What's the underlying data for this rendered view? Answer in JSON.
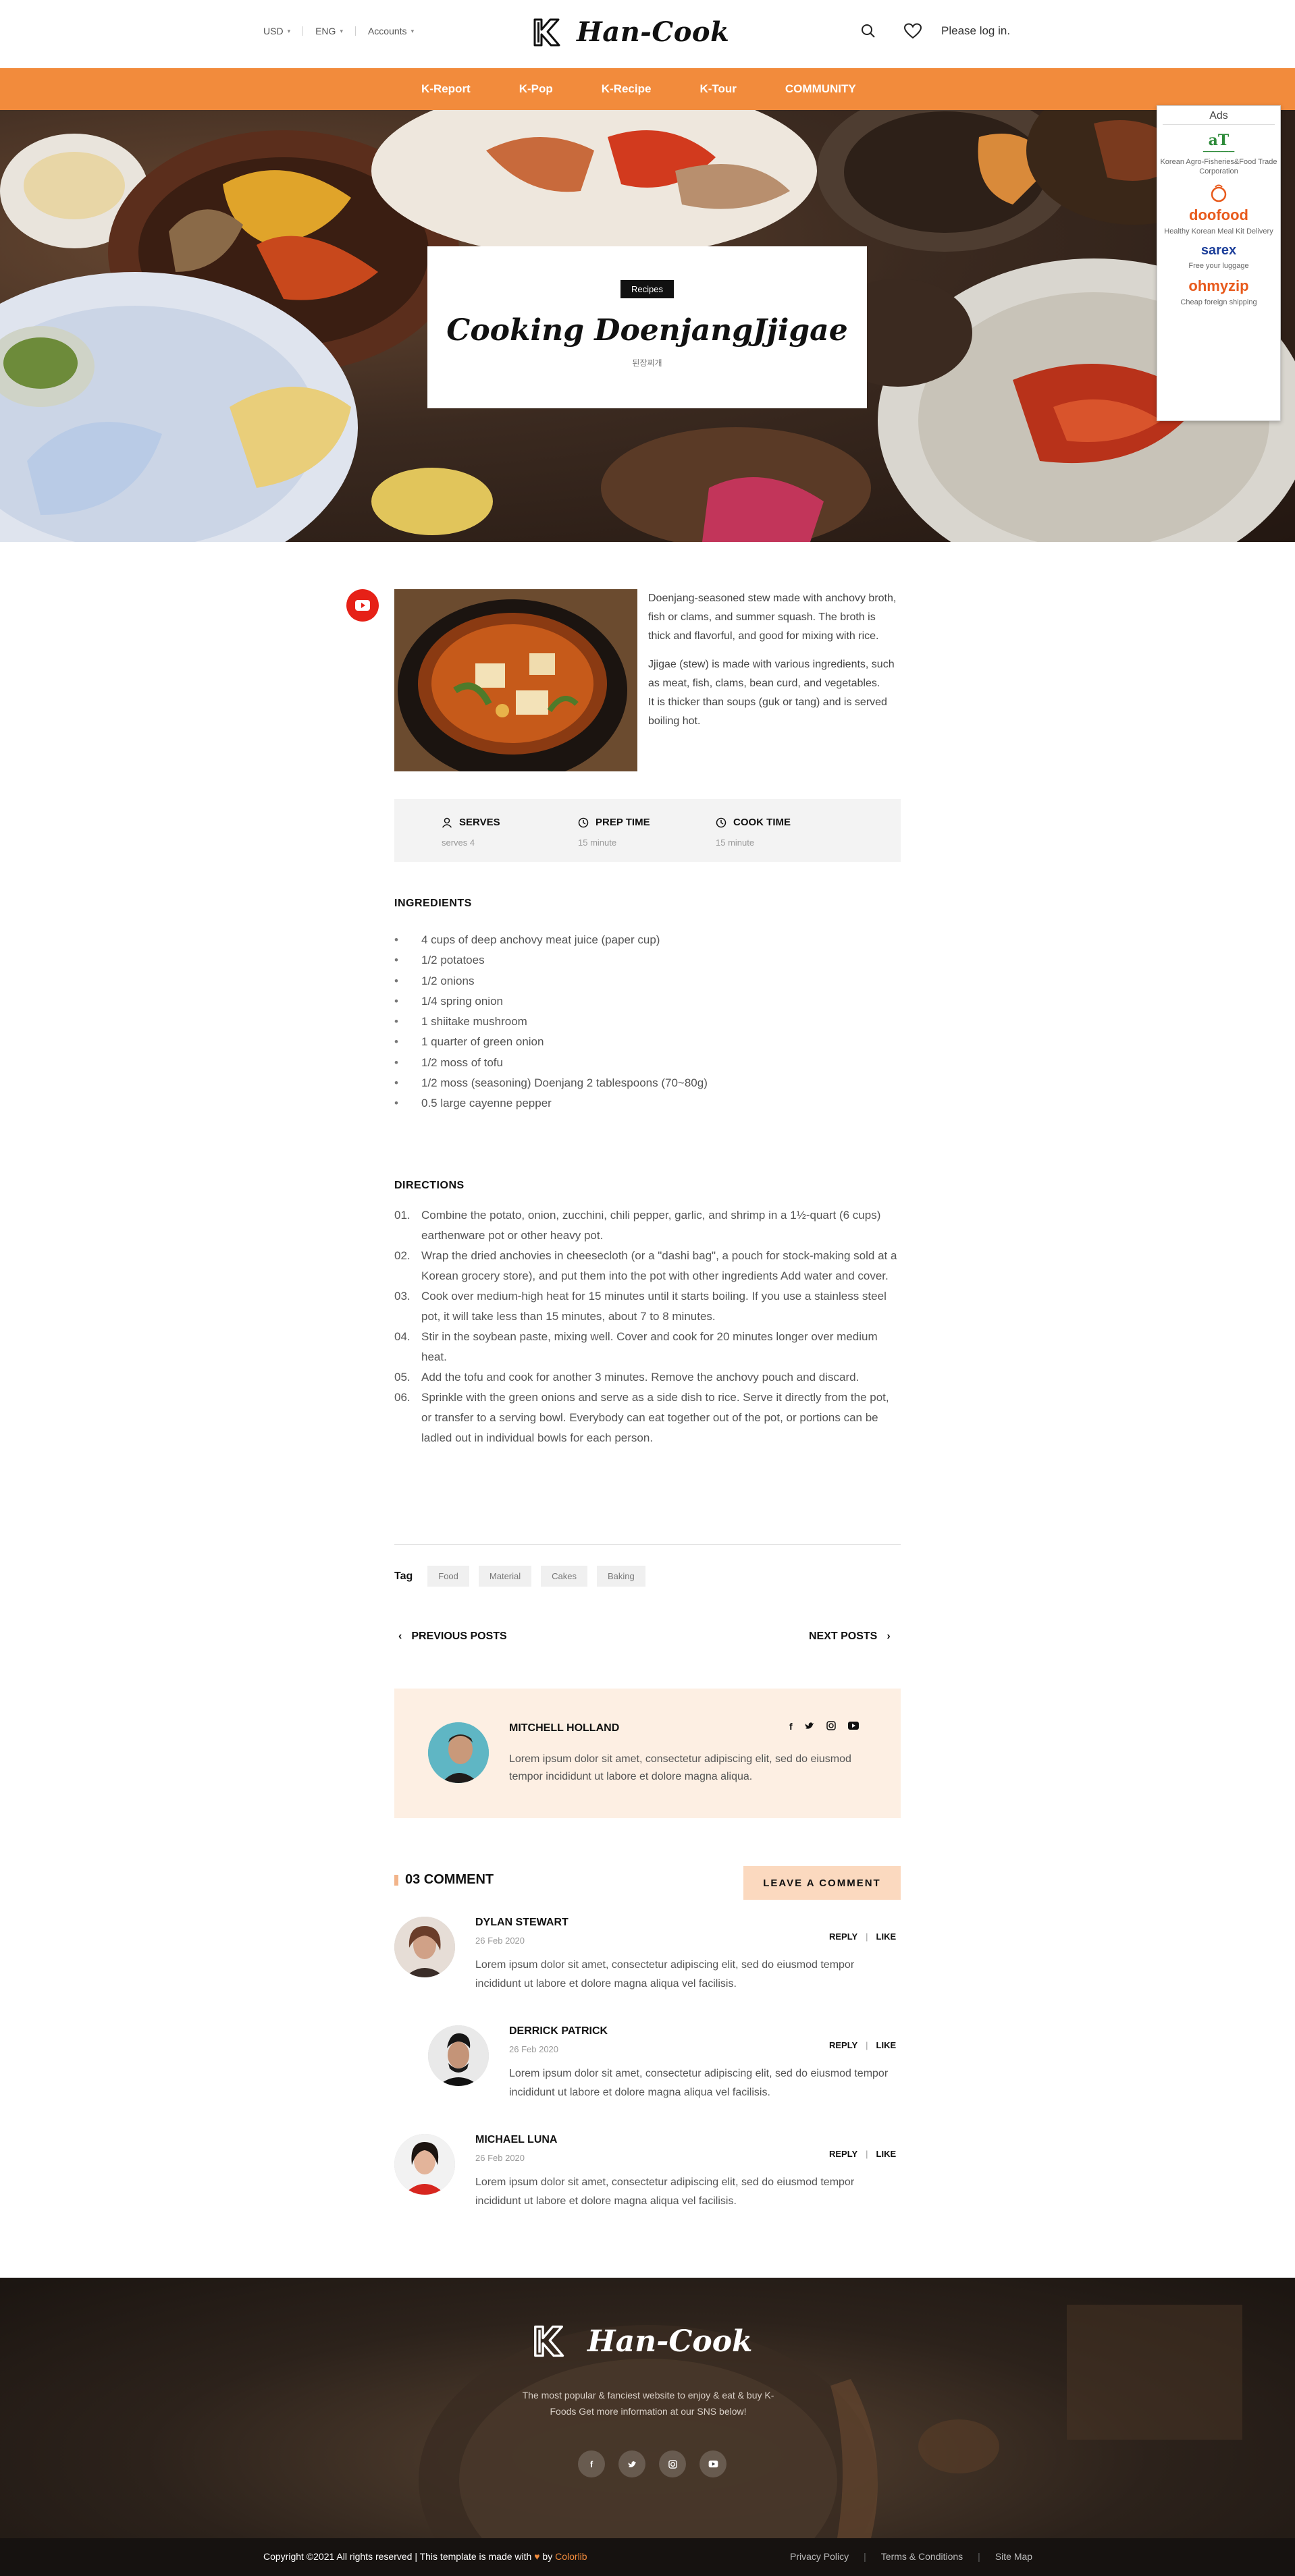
{
  "header": {
    "currency": "USD",
    "language": "ENG",
    "accounts": "Accounts",
    "brand": "Han-Cook",
    "login": "Please log in."
  },
  "nav": {
    "items": [
      "K-Report",
      "K-Pop",
      "K-Recipe",
      "K-Tour",
      "COMMUNITY"
    ]
  },
  "hero": {
    "badge": "Recipes",
    "title": "Cooking DoenjangJjigae",
    "subtitle": "된장찌개"
  },
  "ads": {
    "title": "Ads",
    "items": [
      {
        "brand": "aT",
        "caption": "Korean Agro-Fisheries&Food Trade Corporation"
      },
      {
        "brand": "doofood",
        "caption": "Healthy Korean Meal Kit Delivery"
      },
      {
        "brand": "sarex",
        "caption": "Free your luggage"
      },
      {
        "brand": "ohmyzip",
        "caption": "Cheap foreign shipping"
      }
    ]
  },
  "intro": {
    "paragraphs": [
      "Doenjang-seasoned stew made with anchovy broth, fish or clams, and summer squash. The broth is thick and flavorful, and good for mixing with rice.",
      "Jjigae (stew) is made with various ingredients, such as meat, fish, clams, bean curd, and vegetables.",
      "It is thicker than soups (guk or tang) and is served boiling hot."
    ]
  },
  "meta": {
    "serves_label": "SERVES",
    "serves_value": "serves 4",
    "prep_label": "PREP TIME",
    "prep_value": "15 minute",
    "cook_label": "COOK TIME",
    "cook_value": "15 minute"
  },
  "ingredients": {
    "title": "INGREDIENTS",
    "items": [
      "4 cups of deep anchovy meat juice (paper cup)",
      "1/2 potatoes",
      "1/2 onions",
      "1/4 spring onion",
      "1 shiitake mushroom",
      "1 quarter of green onion",
      "1/2 moss of tofu",
      "1/2 moss (seasoning) Doenjang 2 tablespoons (70~80g)",
      "0.5 large cayenne pepper"
    ]
  },
  "directions": {
    "title": "DIRECTIONS",
    "items": [
      {
        "num": "01.",
        "text": "Combine the potato, onion, zucchini, chili pepper, garlic, and shrimp in a 1½-quart (6 cups) earthenware pot or other heavy pot."
      },
      {
        "num": "02.",
        "text": "Wrap the dried anchovies in cheesecloth (or a \"dashi bag\", a pouch for stock-making sold at a Korean grocery store), and put them into the pot with other ingredients Add water and cover."
      },
      {
        "num": "03.",
        "text": "Cook over medium-high heat for 15 minutes until it starts boiling. If you use a stainless steel pot, it will take less than 15 minutes, about 7 to 8 minutes."
      },
      {
        "num": "04.",
        "text": "Stir in the soybean paste, mixing well. Cover and cook for 20 minutes longer over medium heat."
      },
      {
        "num": "05.",
        "text": "Add the tofu and cook for another 3 minutes. Remove the anchovy pouch and discard."
      },
      {
        "num": "06.",
        "text": "Sprinkle with the green onions and serve as a side dish to rice. Serve it directly from the pot, or transfer to a serving bowl. Everybody can eat together out of the pot, or portions can be ladled out in individual bowls for each person."
      }
    ]
  },
  "tags": {
    "label": "Tag",
    "items": [
      "Food",
      "Material",
      "Cakes",
      "Baking"
    ]
  },
  "post_nav": {
    "prev": "PREVIOUS POSTS",
    "next": "NEXT POSTS"
  },
  "author": {
    "name": "MITCHELL HOLLAND",
    "bio": "Lorem ipsum dolor sit amet, consectetur adipiscing elit, sed do eiusmod tempor incididunt ut labore et dolore magna aliqua.",
    "social": [
      "f",
      "t",
      "ig",
      "yt"
    ]
  },
  "comments": {
    "count_label": "03 COMMENT",
    "leave_label": "LEAVE A COMMENT",
    "reply": "REPLY",
    "like": "LIKE",
    "items": [
      {
        "name": "DYLAN STEWART",
        "date": "26 Feb 2020",
        "text": "Lorem ipsum dolor sit amet, consectetur adipiscing elit, sed do eiusmod tempor incididunt ut labore et dolore magna aliqua vel facilisis."
      },
      {
        "name": "DERRICK PATRICK",
        "date": "26 Feb 2020",
        "text": "Lorem ipsum dolor sit amet, consectetur adipiscing elit, sed do eiusmod tempor incididunt ut labore et dolore magna aliqua vel facilisis."
      },
      {
        "name": "MICHAEL LUNA",
        "date": "26 Feb 2020",
        "text": "Lorem ipsum dolor sit amet, consectetur adipiscing elit, sed do eiusmod tempor incididunt ut labore et dolore magna aliqua vel facilisis."
      }
    ]
  },
  "footer": {
    "brand": "Han-Cook",
    "desc": "The most popular & fanciest website to enjoy & eat & buy K-Foods Get more information at our SNS below!",
    "copyright_pre": "Copyright ©2021 All rights reserved | This template is made with",
    "copyright_by": "by",
    "copyright_author": "Colorlib",
    "links": [
      "Privacy Policy",
      "Terms & Conditions",
      "Site Map"
    ]
  },
  "colors": {
    "accent": "#f28b3c",
    "peach": "#fdefe3",
    "button": "#fbd9bf"
  }
}
